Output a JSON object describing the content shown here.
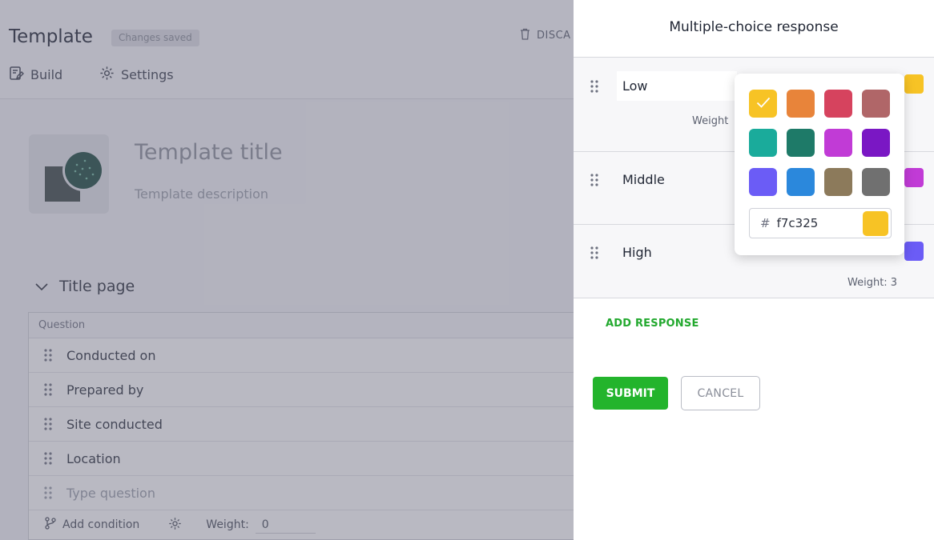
{
  "app": {
    "title": "Template",
    "saved_badge": "Changes saved",
    "discard_label": "DISCA",
    "tabs": [
      {
        "label": "Build"
      },
      {
        "label": "Settings"
      }
    ]
  },
  "template": {
    "title_placeholder": "Template title",
    "description_placeholder": "Template description"
  },
  "section": {
    "title": "Title page",
    "column_header": "Question",
    "rows": [
      {
        "label": "Conducted on"
      },
      {
        "label": "Prepared by"
      },
      {
        "label": "Site conducted"
      },
      {
        "label": "Location"
      }
    ],
    "new_question_placeholder": "Type question",
    "footer": {
      "add_condition": "Add condition",
      "weight_label": "Weight:",
      "weight_value": "0"
    }
  },
  "panel": {
    "title": "Multiple-choice response",
    "responses": [
      {
        "label": "Low",
        "weight_text": "Weight",
        "color": "#f7c325"
      },
      {
        "label": "Middle",
        "weight_text": "",
        "color": "#c13bd6"
      },
      {
        "label": "High",
        "weight_text": "Weight: 3",
        "color": "#6b5cf6"
      }
    ],
    "add_response": "ADD RESPONSE",
    "submit": "SUBMIT",
    "cancel": "CANCEL"
  },
  "color_picker": {
    "selected_color": "#f7c325",
    "swatches": [
      "#f7c325",
      "#e8843a",
      "#d6435e",
      "#b06668",
      "#1aab9b",
      "#1e7a68",
      "#c13bd6",
      "#7a17c4",
      "#6b5cf6",
      "#2b88dc",
      "#8c7a5b",
      "#707070"
    ],
    "hex_prefix": "#",
    "hex_value": "f7c325"
  }
}
